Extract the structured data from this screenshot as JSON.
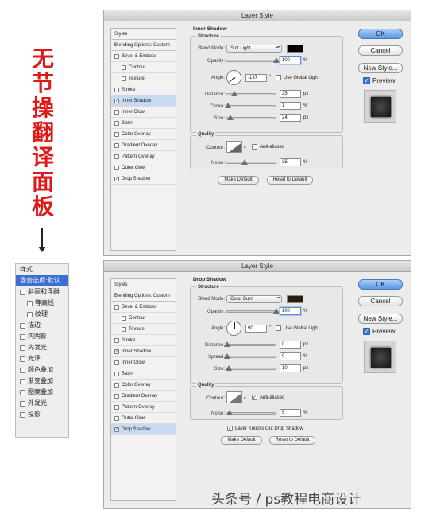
{
  "side_title": [
    "无",
    "节",
    "操",
    "翻",
    "译",
    "面",
    "板"
  ],
  "cn_panel": {
    "header": "样式",
    "items": [
      {
        "label": "混合选项:默认",
        "checkbox": false,
        "sub": false,
        "selected": true
      },
      {
        "label": "斜面和浮雕",
        "checkbox": true,
        "sub": false
      },
      {
        "label": "等高线",
        "checkbox": true,
        "sub": true
      },
      {
        "label": "纹理",
        "checkbox": true,
        "sub": true
      },
      {
        "label": "描边",
        "checkbox": true,
        "sub": false
      },
      {
        "label": "内阴影",
        "checkbox": true,
        "sub": false
      },
      {
        "label": "内发光",
        "checkbox": true,
        "sub": false
      },
      {
        "label": "光泽",
        "checkbox": true,
        "sub": false
      },
      {
        "label": "颜色叠加",
        "checkbox": true,
        "sub": false
      },
      {
        "label": "渐变叠加",
        "checkbox": true,
        "sub": false
      },
      {
        "label": "图案叠加",
        "checkbox": true,
        "sub": false
      },
      {
        "label": "外发光",
        "checkbox": true,
        "sub": false
      },
      {
        "label": "投影",
        "checkbox": true,
        "sub": false
      }
    ]
  },
  "dialog1": {
    "title": "Layer Style",
    "styles_header": "Styles",
    "blending": "Blending Options: Custom",
    "items": [
      {
        "label": "Bevel & Emboss",
        "checked": false,
        "sub": false
      },
      {
        "label": "Contour",
        "checked": false,
        "sub": true
      },
      {
        "label": "Texture",
        "checked": false,
        "sub": true
      },
      {
        "label": "Stroke",
        "checked": false,
        "sub": false
      },
      {
        "label": "Inner Shadow",
        "checked": true,
        "sub": false,
        "selected": true
      },
      {
        "label": "Inner Glow",
        "checked": false,
        "sub": false
      },
      {
        "label": "Satin",
        "checked": false,
        "sub": false
      },
      {
        "label": "Color Overlay",
        "checked": false,
        "sub": false
      },
      {
        "label": "Gradient Overlay",
        "checked": false,
        "sub": false
      },
      {
        "label": "Pattern Overlay",
        "checked": false,
        "sub": false
      },
      {
        "label": "Outer Glow",
        "checked": false,
        "sub": false
      },
      {
        "label": "Drop Shadow",
        "checked": true,
        "sub": false
      }
    ],
    "section_title": "Inner Shadow",
    "structure_title": "Structure",
    "blend_mode_label": "Blend Mode:",
    "blend_mode": "Soft Light",
    "color": "#000000",
    "opacity_label": "Opacity:",
    "opacity": "100",
    "opacity_fraction": 1.0,
    "angle_label": "Angle:",
    "angle": "-137",
    "angle_deg": -137,
    "use_global_light": "Use Global Light",
    "distance_label": "Distance:",
    "distance": "25",
    "distance_fraction": 0.14,
    "choke_label": "Choke:",
    "choke": "1",
    "choke_fraction": 0.01,
    "size_label": "Size:",
    "size": "24",
    "size_fraction": 0.06,
    "quality_title": "Quality",
    "contour_label": "Contour:",
    "anti_aliased": "Anti-aliased",
    "anti_aliased_checked": false,
    "noise_label": "Noise:",
    "noise": "35",
    "noise_fraction": 0.35,
    "make_default": "Make Default",
    "reset_default": "Reset to Default",
    "ok": "OK",
    "cancel": "Cancel",
    "new_style": "New Style...",
    "preview": "Preview",
    "percent": "%",
    "px": "px",
    "degree": "°"
  },
  "dialog2": {
    "title": "Layer Style",
    "styles_header": "Styles",
    "blending": "Blending Options: Custom",
    "items": [
      {
        "label": "Bevel & Emboss",
        "checked": false,
        "sub": false
      },
      {
        "label": "Contour",
        "checked": false,
        "sub": true
      },
      {
        "label": "Texture",
        "checked": false,
        "sub": true
      },
      {
        "label": "Stroke",
        "checked": false,
        "sub": false
      },
      {
        "label": "Inner Shadow",
        "checked": true,
        "sub": false
      },
      {
        "label": "Inner Glow",
        "checked": false,
        "sub": false
      },
      {
        "label": "Satin",
        "checked": false,
        "sub": false
      },
      {
        "label": "Color Overlay",
        "checked": false,
        "sub": false
      },
      {
        "label": "Gradient Overlay",
        "checked": false,
        "sub": false
      },
      {
        "label": "Pattern Overlay",
        "checked": false,
        "sub": false
      },
      {
        "label": "Outer Glow",
        "checked": false,
        "sub": false
      },
      {
        "label": "Drop Shadow",
        "checked": true,
        "sub": false,
        "selected": true
      }
    ],
    "section_title": "Drop Shadow",
    "structure_title": "Structure",
    "blend_mode_label": "Blend Mode:",
    "blend_mode": "Color Burn",
    "color": "#2e1d0c",
    "opacity_label": "Opacity:",
    "opacity": "100",
    "opacity_fraction": 1.0,
    "angle_label": "Angle:",
    "angle": "90",
    "angle_deg": 90,
    "use_global_light": "Use Global Light",
    "distance_label": "Distance:",
    "distance": "0",
    "distance_fraction": 0.0,
    "spread_label": "Spread:",
    "spread": "0",
    "spread_fraction": 0.0,
    "size_label": "Size:",
    "size": "10",
    "size_fraction": 0.04,
    "quality_title": "Quality",
    "contour_label": "Contour:",
    "anti_aliased": "Anti-aliased",
    "anti_aliased_checked": true,
    "noise_label": "Noise:",
    "noise": "5",
    "noise_fraction": 0.05,
    "knocks_out": "Layer Knocks Out Drop Shadow",
    "knocks_out_checked": true,
    "make_default": "Make Default",
    "reset_default": "Reset to Default",
    "ok": "OK",
    "cancel": "Cancel",
    "new_style": "New Style...",
    "preview": "Preview",
    "percent": "%",
    "px": "px",
    "degree": "°"
  },
  "caption": "头条号 / ps教程电商设计"
}
